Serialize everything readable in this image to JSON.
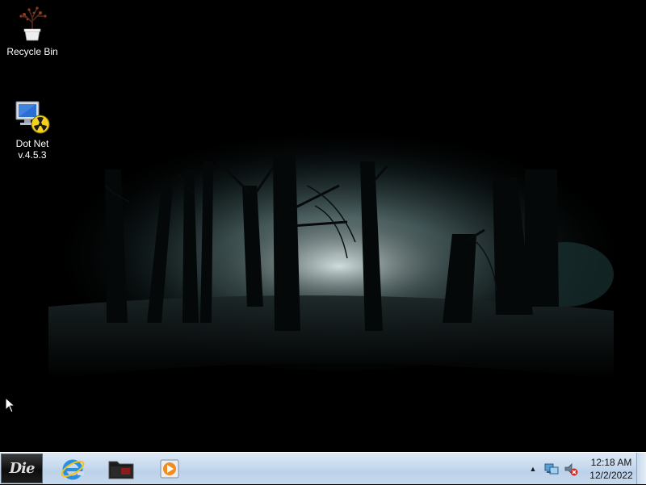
{
  "desktop": {
    "icons": [
      {
        "label": "Recycle Bin",
        "icon": "recycle-bin-icon"
      },
      {
        "label": "Dot Net\nv.4.5.3",
        "icon": "dotnet-installer-icon"
      }
    ]
  },
  "taskbar": {
    "start_label": "Die",
    "pinned": [
      {
        "name": "Internet Explorer",
        "icon": "internet-explorer-icon"
      },
      {
        "name": "File Explorer",
        "icon": "folder-icon"
      },
      {
        "name": "Media Player",
        "icon": "media-player-icon"
      }
    ],
    "tray": {
      "expand_icon": "show-hidden-icons-arrow",
      "network_icon": "network-icon",
      "volume_icon": "volume-muted-icon",
      "time": "12:18 AM",
      "date": "12/2/2022"
    }
  },
  "colors": {
    "taskbar": "#c9dbee",
    "wallpaper": "#000000",
    "mist": "#a9c4c4"
  }
}
